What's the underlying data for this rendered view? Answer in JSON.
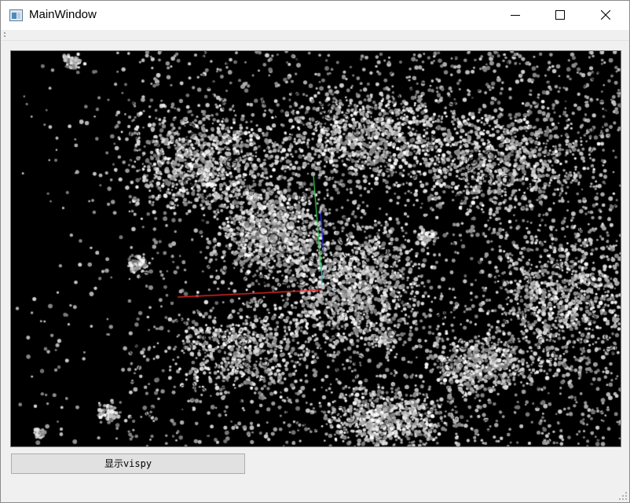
{
  "window": {
    "title": "MainWindow",
    "icons": {
      "app": "app-window-icon",
      "minimize": "minimize-icon",
      "maximize": "maximize-icon",
      "close": "close-icon"
    }
  },
  "toolbar": {
    "grip_icon": "toolbar-grip-icon"
  },
  "viewer": {
    "background_color": "#000000",
    "point_color": "#c8c8c8",
    "axis_colors": {
      "x": "#e02828",
      "y": "#30d050",
      "z": "#2a3cff"
    }
  },
  "actions": {
    "show_vispy_label": "显示vispy"
  }
}
